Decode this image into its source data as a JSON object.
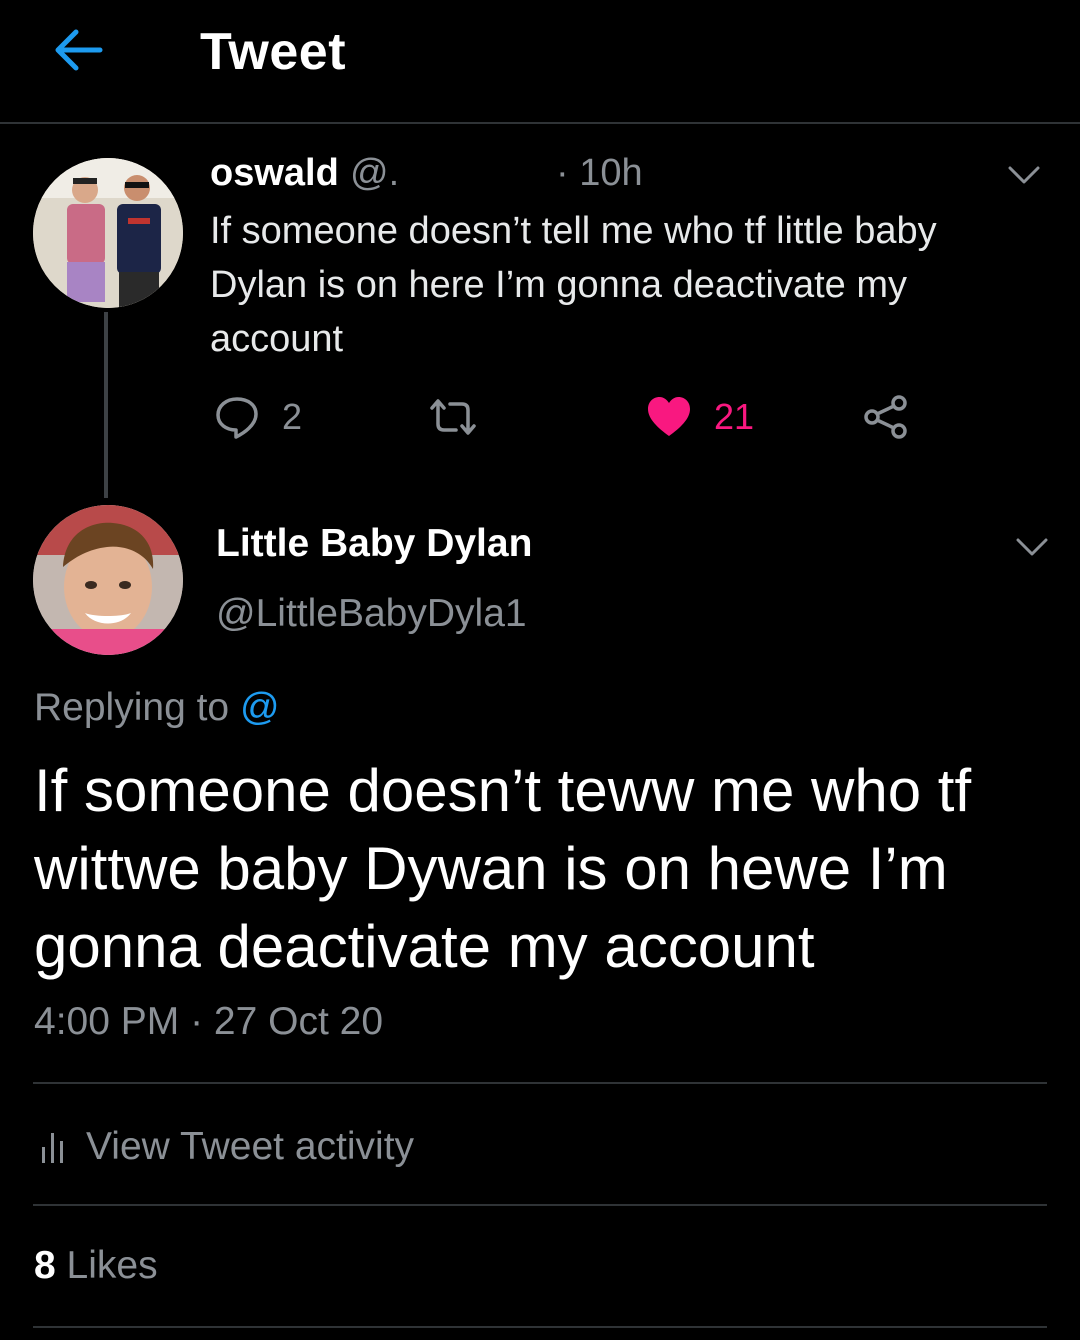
{
  "header": {
    "title": "Tweet",
    "back_icon": "arrow-left-icon",
    "accent": "#1d9bf0"
  },
  "parent_tweet": {
    "name": "oswald",
    "handle": "@.",
    "time": "· 10h",
    "text": "If someone doesn’t tell me who tf little baby Dylan is on here I’m gonna deactivate my account",
    "actions": {
      "reply_count": "2",
      "retweet_count": "",
      "like_count": "21",
      "liked": true,
      "like_color": "#f91880"
    }
  },
  "reply_tweet": {
    "name": "Little Baby Dylan",
    "handle": "@LittleBabyDyla1",
    "replying_label": "Replying to",
    "replying_handle": "@",
    "text": "If someone doesn’t teww me who tf wittwe baby Dywan is on hewe I’m gonna deactivate my account",
    "time": "4:00 PM",
    "separator": " · ",
    "date": "27 Oct 20"
  },
  "activity": {
    "label": "View Tweet activity",
    "icon": "bar-chart-icon"
  },
  "likes": {
    "count": "8",
    "label": " Likes"
  }
}
